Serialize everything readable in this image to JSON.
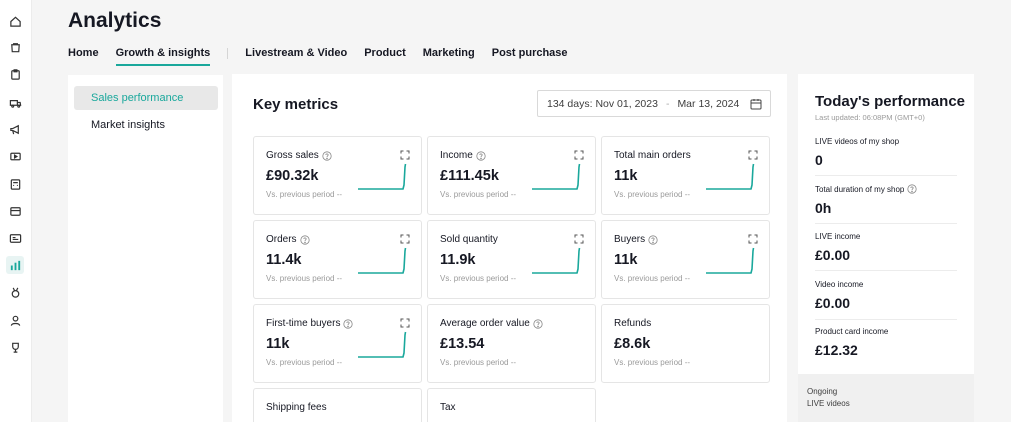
{
  "page": {
    "title": "Analytics"
  },
  "nav": {
    "tabs": [
      {
        "label": "Home"
      },
      {
        "label": "Growth & insights",
        "active": true
      },
      {
        "label": "Livestream & Video"
      },
      {
        "label": "Product"
      },
      {
        "label": "Marketing"
      },
      {
        "label": "Post purchase"
      }
    ]
  },
  "rail": {
    "icons": [
      "home-icon",
      "orders-icon",
      "clipboard-icon",
      "truck-icon",
      "megaphone-icon",
      "video-icon",
      "calculator-icon",
      "store-icon",
      "id-card-icon",
      "analytics-icon",
      "medal-icon",
      "person-icon",
      "trophy-icon"
    ],
    "active_icon": "analytics-icon"
  },
  "sidebar": {
    "items": [
      {
        "label": "Sales performance",
        "active": true
      },
      {
        "label": "Market insights"
      }
    ]
  },
  "key_metrics": {
    "title": "Key metrics",
    "date_range": {
      "days": "134 days:",
      "start": "Nov 01, 2023",
      "end": "Mar 13, 2024"
    },
    "compare_text": "Vs. previous period  --",
    "cards": [
      {
        "label": "Gross sales",
        "value": "£90.32k",
        "help": true,
        "expand": true,
        "spark": true
      },
      {
        "label": "Income",
        "value": "£111.45k",
        "help": true,
        "expand": true,
        "spark": true
      },
      {
        "label": "Total main orders",
        "value": "11k",
        "help": false,
        "expand": true,
        "spark": true
      },
      {
        "label": "Orders",
        "value": "11.4k",
        "help": true,
        "expand": true,
        "spark": true
      },
      {
        "label": "Sold quantity",
        "value": "11.9k",
        "help": false,
        "expand": true,
        "spark": true
      },
      {
        "label": "Buyers",
        "value": "11k",
        "help": true,
        "expand": true,
        "spark": true
      },
      {
        "label": "First-time buyers",
        "value": "11k",
        "help": true,
        "expand": true,
        "spark": true
      },
      {
        "label": "Average order value",
        "value": "£13.54",
        "help": true,
        "expand": false,
        "spark": false
      },
      {
        "label": "Refunds",
        "value": "£8.6k",
        "help": false,
        "expand": false,
        "spark": false
      },
      {
        "label": "Shipping fees"
      },
      {
        "label": "Tax"
      }
    ]
  },
  "today": {
    "title": "Today's performance",
    "updated": "Last updated: 06:08PM (GMT+0)",
    "items": [
      {
        "label": "LIVE videos of my shop",
        "value": "0",
        "help": false
      },
      {
        "label": "Total duration of my shop",
        "value": "0h",
        "help": true
      },
      {
        "label": "LIVE income",
        "value": "£0.00",
        "help": false
      },
      {
        "label": "Video income",
        "value": "£0.00",
        "help": false
      },
      {
        "label": "Product card income",
        "value": "£12.32",
        "help": false
      }
    ],
    "ongoing": {
      "line1": "Ongoing",
      "line2": "LIVE videos"
    }
  },
  "colors": {
    "accent": "#1aa89c",
    "text": "#161823",
    "muted": "#9a9a9a"
  }
}
